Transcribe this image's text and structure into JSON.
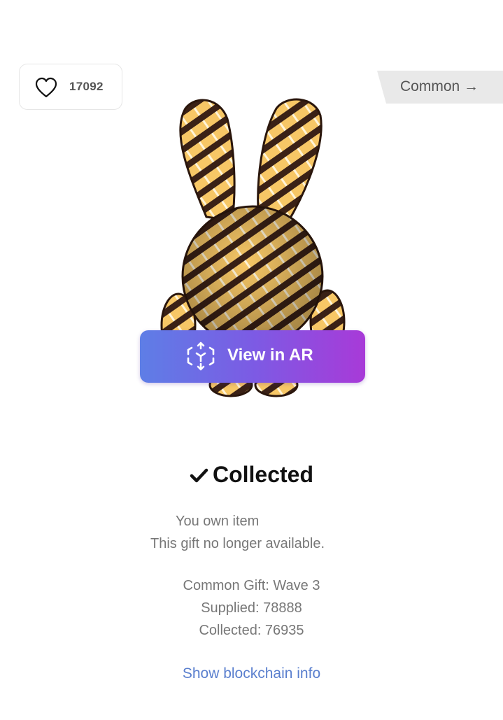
{
  "likes": {
    "count": "17092"
  },
  "rarity": {
    "label": "Common →"
  },
  "ar_button": {
    "label": "View in AR"
  },
  "status": {
    "title": "Collected"
  },
  "ownership": {
    "line1": "You own item",
    "line2": "This gift no longer available."
  },
  "gift": {
    "name": "Common Gift: Wave 3",
    "supplied": "Supplied: 78888",
    "collected": "Collected: 76935"
  },
  "blockchain_link": {
    "label": "Show blockchain info"
  },
  "colors": {
    "ar_gradient_start": "#5e7ee6",
    "ar_gradient_end": "#a83ad8",
    "link": "#5a7fce",
    "muted_text": "#777777",
    "bunny_dark": "#3a2116",
    "bunny_light": "#f7c766"
  },
  "icons": {
    "like": "heart-outline-icon",
    "ar": "ar-cube-icon",
    "check": "checkmark-icon"
  }
}
